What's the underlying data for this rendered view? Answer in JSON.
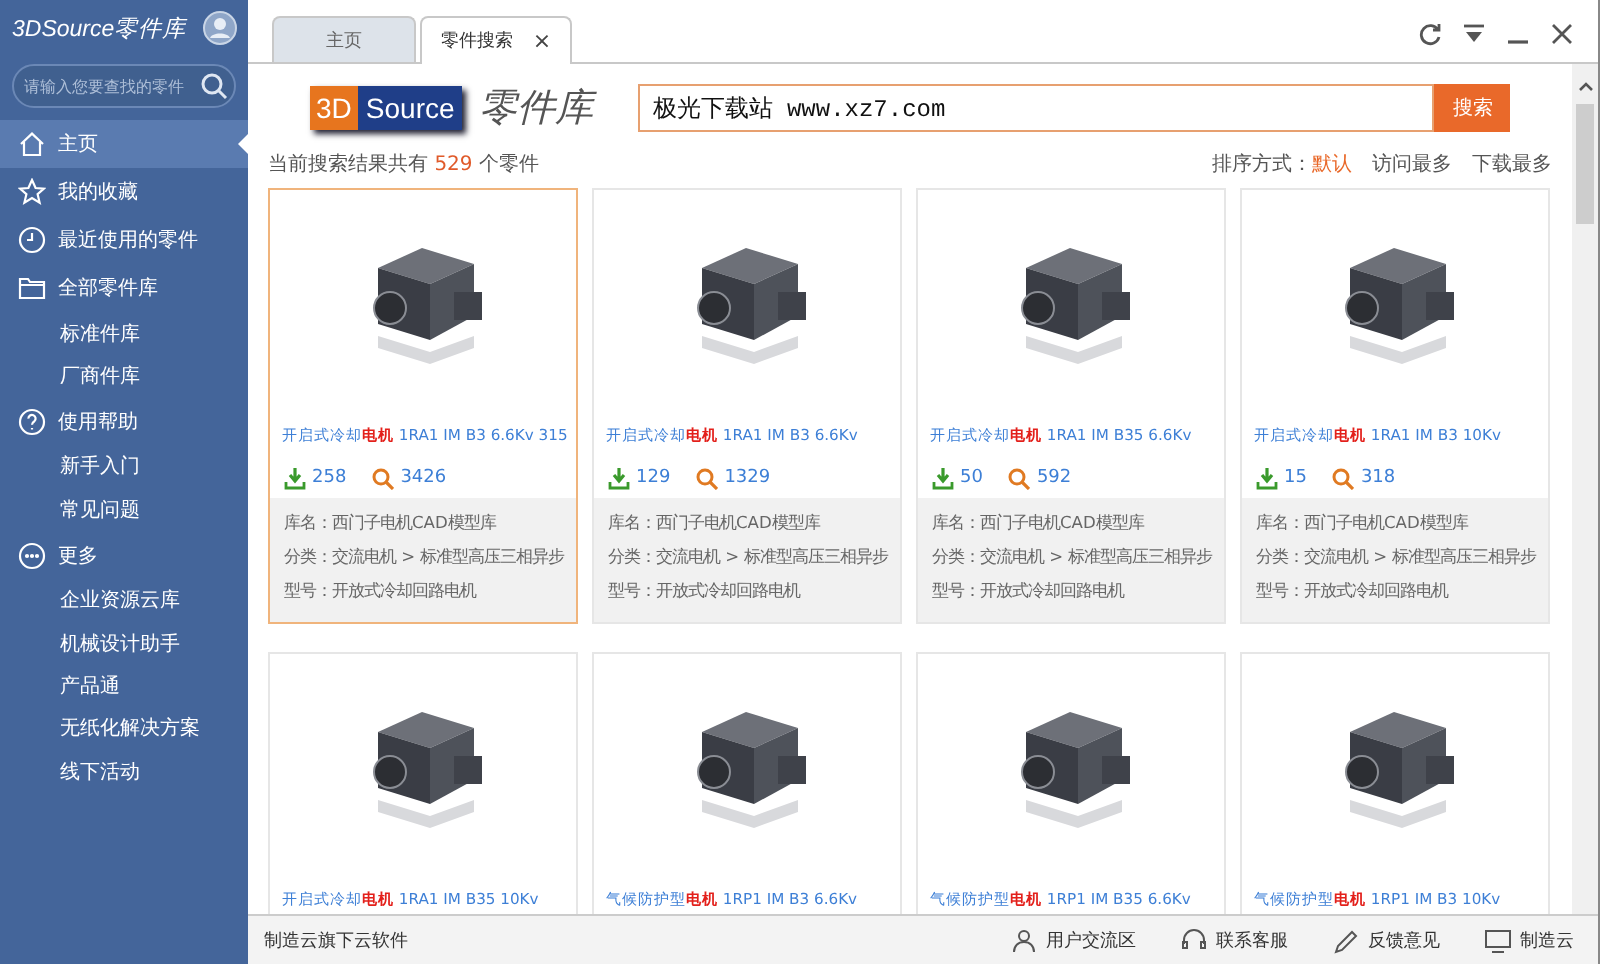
{
  "app": {
    "title": "3DSource零件库"
  },
  "sidebar": {
    "search": {
      "placeholder": "请输入您要查找的零件"
    },
    "items": [
      {
        "kind": "section",
        "label": "主页",
        "selected": true
      },
      {
        "kind": "section",
        "label": "我的收藏",
        "selected": false
      },
      {
        "kind": "section",
        "label": "最近使用的零件",
        "selected": false
      },
      {
        "kind": "section",
        "label": "全部零件库",
        "selected": false
      },
      {
        "kind": "sub",
        "label": "标准件库",
        "selected": false
      },
      {
        "kind": "sub",
        "label": "厂商件库",
        "selected": false
      },
      {
        "kind": "section",
        "label": "使用帮助",
        "selected": false
      },
      {
        "kind": "sub",
        "label": "新手入门",
        "selected": false
      },
      {
        "kind": "sub",
        "label": "常见问题",
        "selected": false
      },
      {
        "kind": "section",
        "label": "更多",
        "selected": false
      },
      {
        "kind": "sub",
        "label": "企业资源云库",
        "selected": false
      },
      {
        "kind": "sub",
        "label": "机械设计助手",
        "selected": false
      },
      {
        "kind": "sub",
        "label": "产品通",
        "selected": false
      },
      {
        "kind": "sub",
        "label": "无纸化解决方案",
        "selected": false
      },
      {
        "kind": "sub",
        "label": "线下活动",
        "selected": false
      }
    ]
  },
  "tabs": [
    {
      "label": "主页",
      "selected": false
    },
    {
      "label": "零件搜索",
      "selected": true,
      "close": "×"
    }
  ],
  "logo": {
    "part1": "3D",
    "part2": "Source",
    "name": "零件库"
  },
  "search": {
    "value": "极光下载站 www.xz7.com",
    "button": "搜索"
  },
  "results": {
    "prefix": "当前搜索结果共有",
    "count": "529",
    "suffix": "个零件"
  },
  "sort": {
    "label": "排序方式：",
    "options": [
      {
        "label": "默认",
        "selected": true
      },
      {
        "label": "访问最多",
        "selected": false
      },
      {
        "label": "下载最多",
        "selected": false
      }
    ]
  },
  "cards": [
    {
      "title": "开启式冷却**电机** 1RA1 IM B3 6.6Kv 315",
      "downloads": "258",
      "views": "3426",
      "info": [
        "库名：西门子电机CAD模型库",
        "分类：交流电机 > 标准型高压三相异步",
        "型号：开放式冷却回路电机"
      ],
      "selected": true
    },
    {
      "title": "开启式冷却**电机** 1RA1 IM B3 6.6Kv",
      "downloads": "129",
      "views": "1329",
      "info": [
        "库名：西门子电机CAD模型库",
        "分类：交流电机 > 标准型高压三相异步",
        "型号：开放式冷却回路电机"
      ],
      "selected": false
    },
    {
      "title": "开启式冷却**电机** 1RA1 IM B35 6.6Kv",
      "downloads": "50",
      "views": "592",
      "info": [
        "库名：西门子电机CAD模型库",
        "分类：交流电机 > 标准型高压三相异步",
        "型号：开放式冷却回路电机"
      ],
      "selected": false
    },
    {
      "title": "开启式冷却**电机** 1RA1 IM B3 10Kv",
      "downloads": "15",
      "views": "318",
      "info": [
        "库名：西门子电机CAD模型库",
        "分类：交流电机 > 标准型高压三相异步",
        "型号：开放式冷却回路电机"
      ],
      "selected": false
    },
    {
      "title": "开启式冷却**电机** 1RA1 IM B35 10Kv",
      "selected": false
    },
    {
      "title": "气候防护型**电机** 1RP1 IM B3 6.6Kv",
      "selected": false
    },
    {
      "title": "气候防护型**电机** 1RP1 IM B35 6.6Kv",
      "selected": false
    },
    {
      "title": "气候防护型**电机** 1RP1 IM B3 10Kv",
      "selected": false
    }
  ],
  "status_bar": {
    "left": "制造云旗下云软件",
    "links": [
      {
        "label": "用户交流区"
      },
      {
        "label": "联系客服"
      },
      {
        "label": "反馈意见"
      },
      {
        "label": "制造云"
      }
    ]
  }
}
